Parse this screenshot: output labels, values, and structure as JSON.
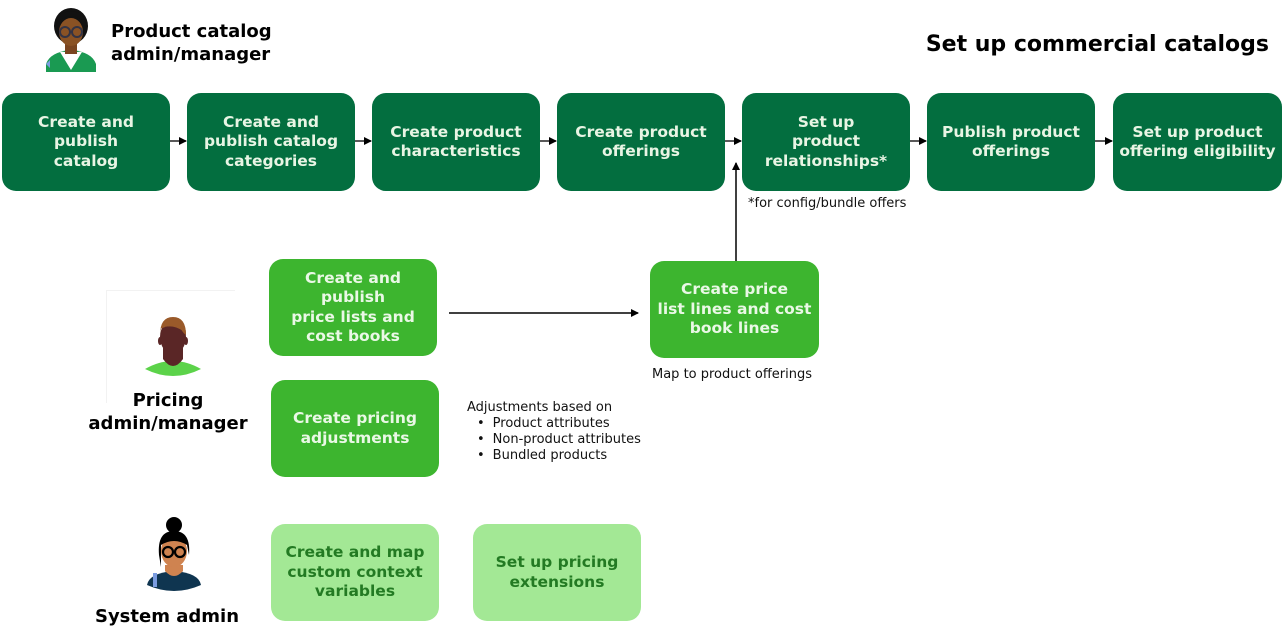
{
  "title": "Set up commercial catalogs",
  "personas": {
    "catalog": {
      "label_line1": "Product catalog",
      "label_line2": "admin/manager",
      "icon": "person-with-glasses-icon"
    },
    "pricing": {
      "label_line1": "Pricing",
      "label_line2": "admin/manager",
      "icon": "person-icon"
    },
    "system": {
      "label": "System admin",
      "icon": "person-with-bun-icon"
    }
  },
  "catalog_steps": [
    {
      "lines": [
        "Create and",
        "publish",
        "catalog"
      ]
    },
    {
      "lines": [
        "Create and",
        "publish catalog",
        "categories"
      ]
    },
    {
      "lines": [
        "Create product",
        "characteristics"
      ]
    },
    {
      "lines": [
        "Create product",
        "offerings"
      ]
    },
    {
      "lines": [
        "Set up",
        "product",
        "relationships*"
      ]
    },
    {
      "lines": [
        "Publish product",
        "offerings"
      ]
    },
    {
      "lines": [
        "Set up product",
        "offering eligibility"
      ]
    }
  ],
  "relationships_note": "*for config/bundle offers",
  "pricing_steps": {
    "price_lists": {
      "lines": [
        "Create and",
        "publish",
        "price lists and",
        "cost books"
      ]
    },
    "price_lines": {
      "lines": [
        "Create price",
        "list lines and cost",
        "book lines"
      ]
    },
    "adjustments": {
      "lines": [
        "Create pricing",
        "adjustments"
      ]
    }
  },
  "price_lines_note": "Map to product offerings",
  "adjustments_note": {
    "heading": "Adjustments based on",
    "items": [
      "Product attributes",
      "Non-product attributes",
      "Bundled products"
    ]
  },
  "system_steps": {
    "context_vars": {
      "lines": [
        "Create and map",
        "custom context",
        "variables"
      ]
    },
    "extensions": {
      "lines": [
        "Set up pricing",
        "extensions"
      ]
    }
  },
  "colors": {
    "catalog_box": "#036e3f",
    "pricing_box": "#3db52f",
    "system_box": "#a3e895",
    "system_text": "#237a23"
  }
}
